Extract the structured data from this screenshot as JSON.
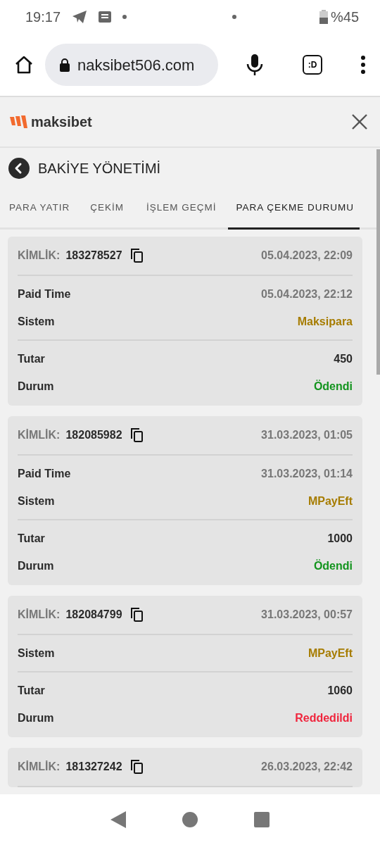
{
  "status_bar": {
    "time": "19:17",
    "battery": "%45"
  },
  "browser": {
    "url": "naksibet506.com",
    "tab_label": ":D"
  },
  "site": {
    "logo": "maksibet"
  },
  "page": {
    "title": "BAKİYE YÖNETİMİ"
  },
  "tabs": [
    {
      "label": "PARA YATIR",
      "selected": false
    },
    {
      "label": "ÇEKİM",
      "selected": false
    },
    {
      "label": "İŞLEM GEÇMİ",
      "selected": false
    },
    {
      "label": "PARA ÇEKME DURUMU",
      "selected": true
    }
  ],
  "withdrawals": [
    {
      "id_label": "KİMLİK:",
      "id": "183278527",
      "date": "05.04.2023, 22:09",
      "paid_time_label": "Paid Time",
      "paid_time": "05.04.2023, 22:12",
      "system_label": "Sistem",
      "system": "Maksipara",
      "amount_label": "Tutar",
      "amount": "450",
      "status_label": "Durum",
      "status": "Ödendi",
      "color": "#13941e"
    },
    {
      "id_label": "KİMLİK:",
      "id": "182085982",
      "date": "31.03.2023, 01:05",
      "paid_time_label": "Paid Time",
      "paid_time": "31.03.2023, 01:14",
      "system_label": "Sistem",
      "system": "MPayEft",
      "amount_label": "Tutar",
      "amount": "1000",
      "status_label": "Durum",
      "status": "Ödendi",
      "color": "#13941e"
    },
    {
      "id_label": "KİMLİK:",
      "id": "182084799",
      "date": "31.03.2023, 00:57",
      "system_label": "Sistem",
      "system": "MPayEft",
      "amount_label": "Tutar",
      "amount": "1060",
      "status_label": "Durum",
      "status": "Reddedildi",
      "color": "#f0243c"
    },
    {
      "id_label": "KİMLİK:",
      "id": "181327242",
      "date": "26.03.2023, 22:42"
    }
  ]
}
